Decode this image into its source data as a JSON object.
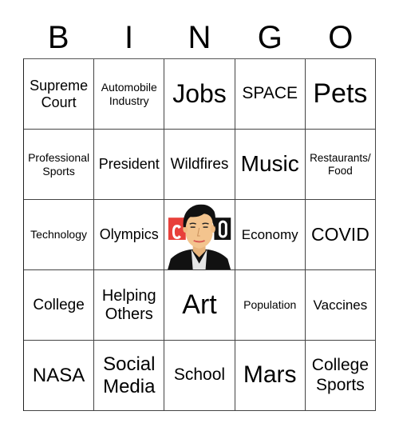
{
  "header": {
    "letters": [
      "B",
      "I",
      "N",
      "G",
      "O"
    ]
  },
  "grid": {
    "rows": [
      [
        "Supreme Court",
        "Automobile Industry",
        "Jobs",
        "SPACE",
        "Pets"
      ],
      [
        "Professional Sports",
        "President",
        "Wildfires",
        "Music",
        "Restaurants/ Food"
      ],
      [
        "Technology",
        "Olympics",
        "FREE (image)",
        "Economy",
        "COVID"
      ],
      [
        "College",
        "Helping Others",
        "Art",
        "Population",
        "Vaccines"
      ],
      [
        "NASA",
        "Social Media",
        "School",
        "Mars",
        "College Sports"
      ]
    ],
    "cells": {
      "r0c0": "Supreme Court",
      "r0c1": "Automobile Industry",
      "r0c2": "Jobs",
      "r0c3": "SPACE",
      "r0c4": "Pets",
      "r1c0": "Professional Sports",
      "r1c1": "President",
      "r1c2": "Wildfires",
      "r1c3": "Music",
      "r1c4": "Restaurants/ Food",
      "r2c0": "Technology",
      "r2c1": "Olympics",
      "r2c3": "Economy",
      "r2c4": "COVID",
      "r3c0": "College",
      "r3c1": "Helping Others",
      "r3c2": "Art",
      "r3c3": "Population",
      "r3c4": "Vaccines",
      "r4c0": "NASA",
      "r4c1": "Social Media",
      "r4c2": "School",
      "r4c3": "Mars",
      "r4c4": "College Sports"
    },
    "free_space": {
      "icon": "news-anchor-portrait-icon",
      "colors": {
        "logo_red": "#e8403a",
        "logo_black": "#111111",
        "skin": "#f3c48e",
        "hair": "#111111",
        "suit": "#111111",
        "shirt": "#e6e6e6"
      }
    }
  }
}
